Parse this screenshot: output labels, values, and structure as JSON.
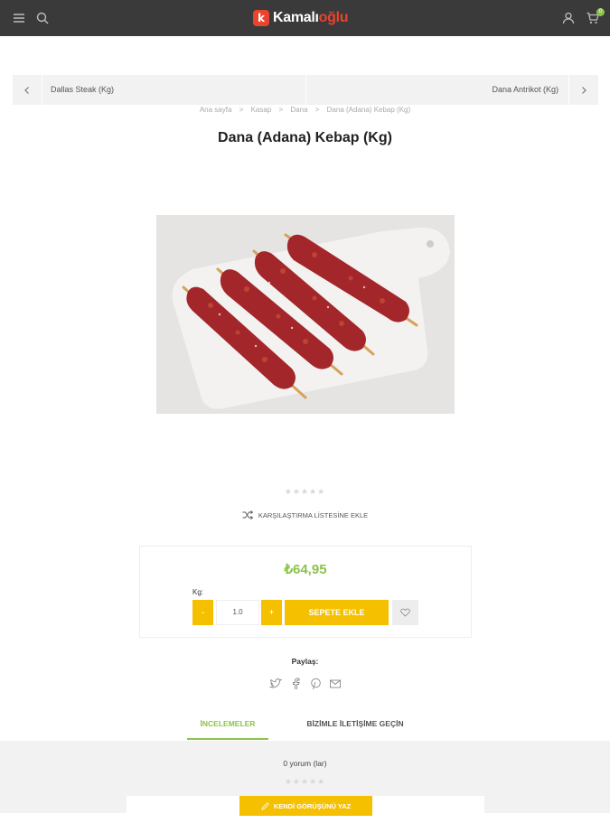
{
  "header": {
    "logo_mark": "k",
    "logo_text_main": "Kamalı",
    "logo_text_accent": "oğlu",
    "cart_count": "0",
    "icons": [
      "menu-icon",
      "search-icon",
      "user-icon",
      "cart-icon"
    ]
  },
  "product_nav": {
    "prev_label": "Dallas Steak (Kg)",
    "next_label": "Dana Antrikot (Kg)"
  },
  "breadcrumb": [
    "Ana sayfa",
    "Kasap",
    "Dana",
    "Dana (Adana) Kebap (Kg)"
  ],
  "breadcrumb_separator": ">",
  "product": {
    "title": "Dana (Adana) Kebap (Kg)",
    "rating_stars": "★★★★★",
    "rating_value": 0,
    "compare_label": "KARŞILAŞTIRMA LİSTESİNE EKLE",
    "price": "₺64,95",
    "qty_label": "Kg:",
    "qty_value": "1.0",
    "minus_label": "-",
    "plus_label": "+",
    "add_to_cart_label": "SEPETE EKLE"
  },
  "share": {
    "label": "Paylaş:",
    "icons": [
      "twitter-icon",
      "facebook-icon",
      "pinterest-icon",
      "email-icon"
    ]
  },
  "tabs": {
    "reviews": "İNCELEMELER",
    "contact": "BİZİMLE İLETİŞİME GEÇİN",
    "active": "reviews"
  },
  "reviews": {
    "count_text": "0 yorum (lar)",
    "stars": "★★★★★",
    "write_label": "KENDİ GÖRÜŞÜNÜ YAZ"
  },
  "colors": {
    "accent_green": "#8bc34a",
    "button_yellow": "#f5c000",
    "header_bg": "#3a3a3a",
    "brand_red": "#e8442e"
  }
}
